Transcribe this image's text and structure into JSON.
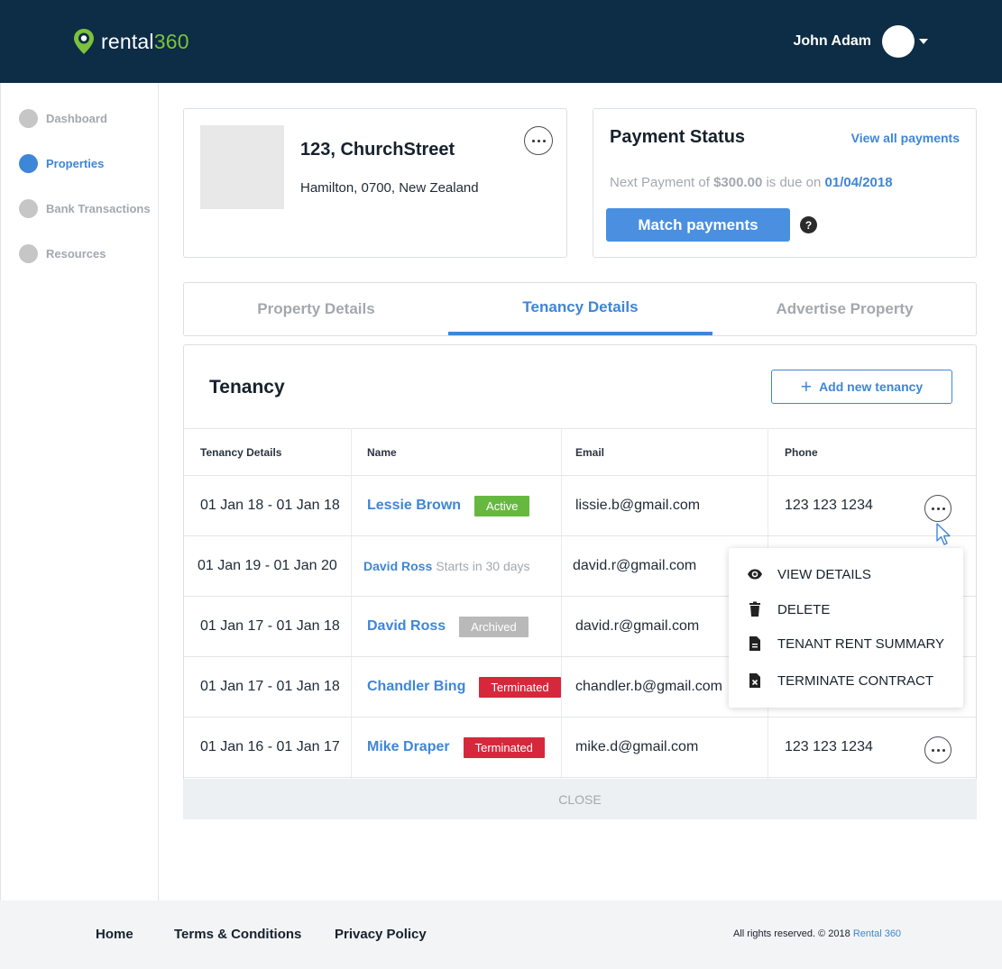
{
  "header": {
    "logo": {
      "text_main": "rental",
      "text_accent": "360"
    },
    "user_name": "John Adam"
  },
  "colors": {
    "header_bg": "#0d2c45",
    "accent": "#3e86d8",
    "brand_green": "#7dc13c",
    "active": "#66b83f",
    "terminated": "#d6283c",
    "archived": "#b9b9b9"
  },
  "sidebar": {
    "items": [
      {
        "label": "Dashboard",
        "active": false
      },
      {
        "label": "Properties",
        "active": true
      },
      {
        "label": "Bank Transactions",
        "active": false
      },
      {
        "label": "Resources",
        "active": false
      }
    ]
  },
  "property": {
    "title": "123, ChurchStreet",
    "address": "Hamilton, 0700, New Zealand"
  },
  "payment": {
    "title": "Payment Status",
    "view_all": "View all payments",
    "note_prefix": "Next Payment of ",
    "amount": "$300.00",
    "note_middle": " is due on ",
    "due_date": "01/04/2018",
    "match_button": "Match payments",
    "help": "?"
  },
  "tabs": [
    {
      "label": "Property Details",
      "active": false
    },
    {
      "label": "Tenancy Details",
      "active": true
    },
    {
      "label": "Advertise Property",
      "active": false
    }
  ],
  "tenancy": {
    "title": "Tenancy",
    "add_button": "Add new tenancy",
    "columns": [
      "Tenancy Details",
      "Name",
      "Email",
      "Phone"
    ],
    "rows": [
      {
        "period": "01 Jan 18 - 01 Jan 18",
        "name": "Lessie Brown",
        "status": "Active",
        "email": "lissie.b@gmail.com",
        "phone": "123 123 1234"
      },
      {
        "period": "01 Jan 19 - 01 Jan 20",
        "name": "David Ross",
        "status": "Starts in 30 days",
        "email": "david.r@gmail.com",
        "phone": ""
      },
      {
        "period": "01 Jan 17 - 01 Jan 18",
        "name": "David Ross",
        "status": "Archived",
        "email": "david.r@gmail.com",
        "phone": ""
      },
      {
        "period": "01 Jan 17 - 01 Jan 18",
        "name": "Chandler Bing",
        "status": "Terminated",
        "email": "chandler.b@gmail.com",
        "phone": ""
      },
      {
        "period": "01 Jan 16 - 01 Jan 17",
        "name": "Mike Draper",
        "status": "Terminated",
        "email": "mike.d@gmail.com",
        "phone": "123 123 1234"
      }
    ],
    "close_label": "CLOSE"
  },
  "row_menu": {
    "items": [
      {
        "label": "VIEW DETAILS",
        "icon": "eye-icon"
      },
      {
        "label": "DELETE",
        "icon": "trash-icon"
      },
      {
        "label": "TENANT RENT SUMMARY",
        "icon": "document-icon"
      },
      {
        "label": "TERMINATE CONTRACT",
        "icon": "document-x-icon"
      }
    ]
  },
  "footer": {
    "links": [
      "Home",
      "Terms & Conditions",
      "Privacy Policy"
    ],
    "copyright": "All rights reserved. © 2018 ",
    "brand": "Rental 360"
  }
}
